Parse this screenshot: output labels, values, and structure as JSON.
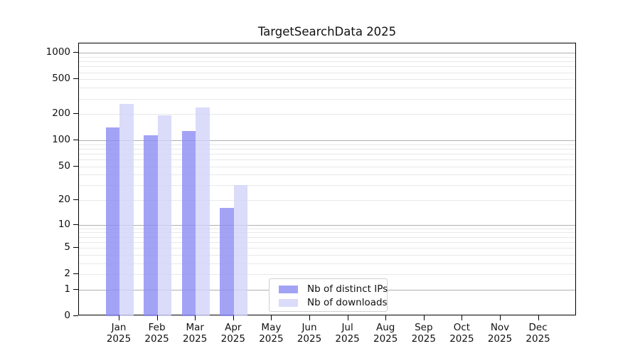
{
  "chart_data": {
    "type": "bar",
    "title": "TargetSearchData 2025",
    "categories": [
      "Jan 2025",
      "Feb 2025",
      "Mar 2025",
      "Apr 2025",
      "May 2025",
      "Jun 2025",
      "Jul 2025",
      "Aug 2025",
      "Sep 2025",
      "Oct 2025",
      "Nov 2025",
      "Dec 2025"
    ],
    "series": [
      {
        "name": "Nb of distinct IPs",
        "color": "#8c8cf4",
        "alpha": 0.8,
        "values": [
          140,
          115,
          128,
          16,
          0,
          0,
          0,
          0,
          0,
          0,
          0,
          0
        ]
      },
      {
        "name": "Nb of downloads",
        "color": "#d2d2f9",
        "alpha": 0.8,
        "values": [
          260,
          195,
          240,
          30,
          0,
          0,
          0,
          0,
          0,
          0,
          0,
          0
        ]
      }
    ],
    "xlabel": "",
    "ylabel": "",
    "yscale": "log1p",
    "yticks": [
      0,
      1,
      2,
      5,
      10,
      20,
      50,
      100,
      200,
      500,
      1000
    ],
    "ylim": [
      0,
      1285
    ],
    "grid": true,
    "legend_position": "lower center",
    "colors": {
      "grid_major": "#b0b0b0",
      "grid_minor": "#e8e8e8",
      "spine": "#000000",
      "text": "#111111",
      "background": "#ffffff"
    }
  }
}
